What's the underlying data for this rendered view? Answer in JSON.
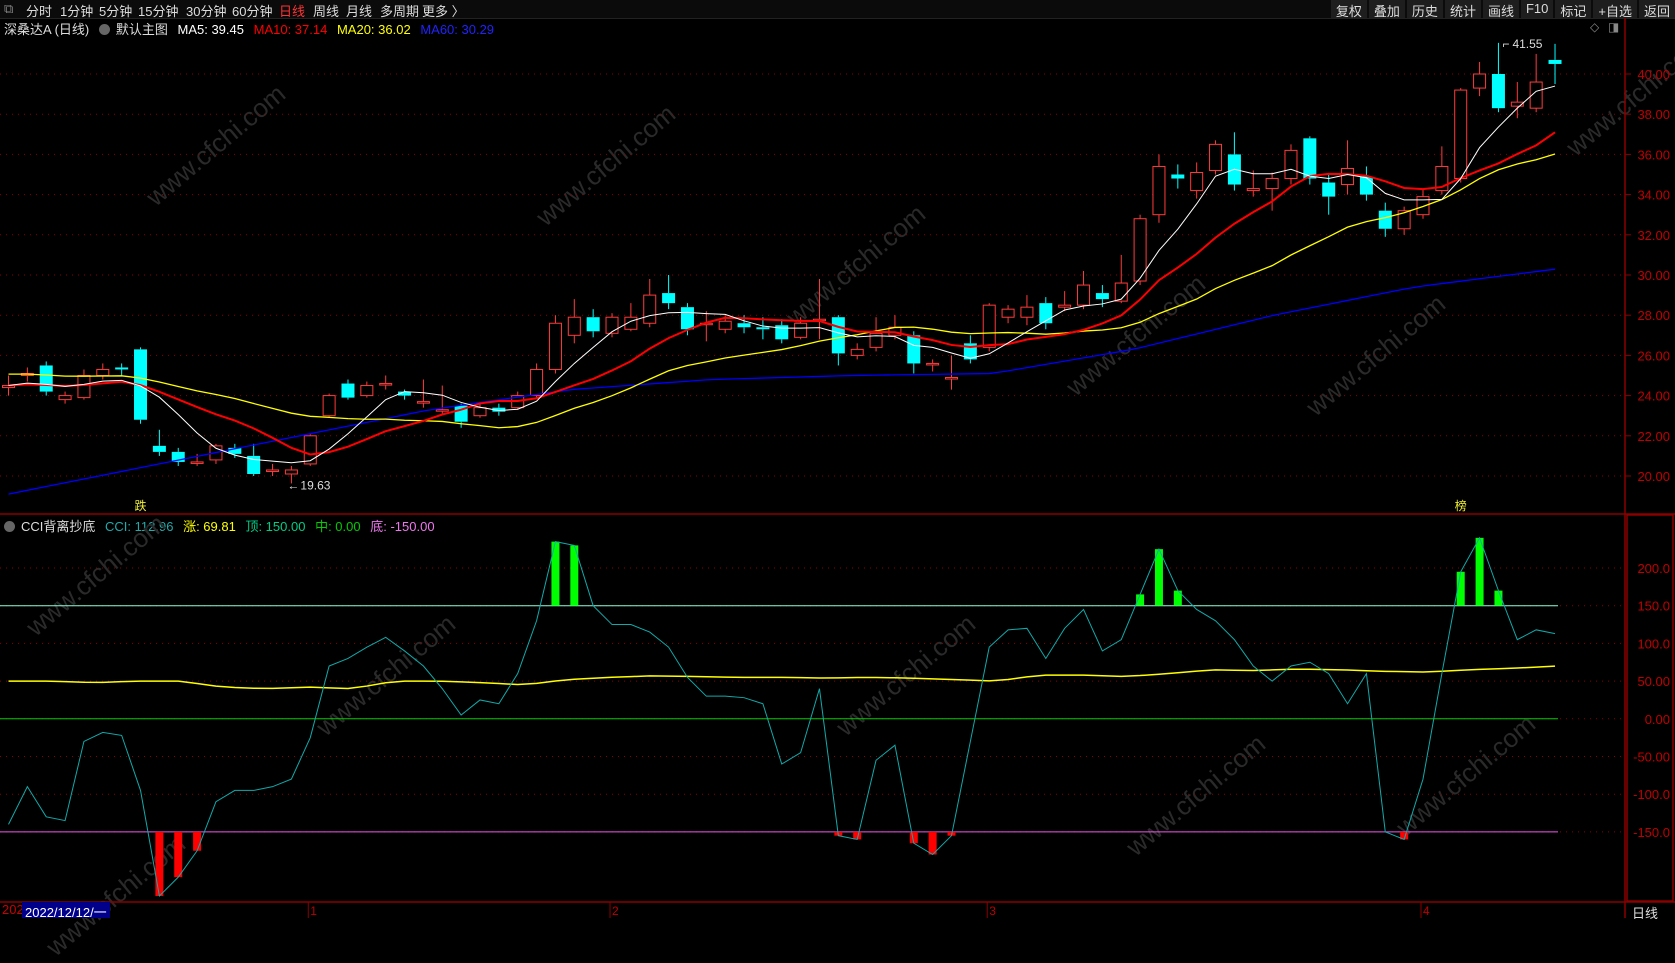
{
  "toolbar": {
    "tabs": [
      "分时",
      "1分钟",
      "5分钟",
      "15分钟",
      "30分钟",
      "60分钟",
      "日线",
      "周线",
      "月线",
      "多周期",
      "更多 〉"
    ],
    "active": "日线",
    "right_buttons": [
      "复权",
      "叠加",
      "历史",
      "统计",
      "画线",
      "F10",
      "标记",
      "+自选",
      "返回"
    ]
  },
  "main_legend": {
    "title": "深桑达A (日线)",
    "template": "默认主图",
    "ma5": "MA5: 39.45",
    "ma10": "MA10: 37.14",
    "ma20": "MA20: 36.02",
    "ma60": "MA60: 30.29"
  },
  "cci_legend": {
    "title": "CCI背离抄底",
    "cci": "CCI: 112.96",
    "zhang": "涨: 69.81",
    "ding": "顶: 150.00",
    "zhong": "中: 0.00",
    "di": "底: -150.00"
  },
  "annotations": {
    "high": "41.55",
    "low": "19.63",
    "signal_left": "跌",
    "signal_right": "榜"
  },
  "bottom": {
    "year_prefix": "202",
    "date": "2022/12/12/一",
    "months": [
      "1",
      "2",
      "3",
      "4"
    ],
    "period": "日线"
  },
  "watermark": "www.cfchi.com",
  "colors": {
    "up": "#ff3b3b",
    "down": "#00ffff",
    "ma5": "#ffffff",
    "ma10": "#ff0000",
    "ma20": "#ffff00",
    "ma60": "#0000ff",
    "grid": "#8b0000",
    "axis": "#c00000"
  },
  "chart_data": [
    {
      "type": "candlestick",
      "title": "深桑达A (日线)",
      "yticks": [
        "20.00",
        "22.00",
        "24.00",
        "26.00",
        "28.00",
        "30.00",
        "32.00",
        "34.00",
        "36.00",
        "38.00",
        "40.00"
      ],
      "ylim": [
        18.5,
        41.8
      ],
      "month_label_index": [
        16,
        32,
        52,
        75
      ],
      "ohlc": [
        [
          24.4,
          24.5,
          25.0,
          24.0
        ],
        [
          25.0,
          25.1,
          25.4,
          24.7
        ],
        [
          25.5,
          24.2,
          25.7,
          24.0
        ],
        [
          23.8,
          24.0,
          24.2,
          23.6
        ],
        [
          23.9,
          25.0,
          25.3,
          23.8
        ],
        [
          25.0,
          25.3,
          25.6,
          24.8
        ],
        [
          25.4,
          25.3,
          25.6,
          25.0
        ],
        [
          26.3,
          22.8,
          26.4,
          22.6
        ],
        [
          21.5,
          21.2,
          22.3,
          21.0
        ],
        [
          21.2,
          20.7,
          21.4,
          20.5
        ],
        [
          20.7,
          20.7,
          21.1,
          20.5
        ],
        [
          20.8,
          21.5,
          21.6,
          20.6
        ],
        [
          21.4,
          21.1,
          21.6,
          20.9
        ],
        [
          21.0,
          20.1,
          21.6,
          20.0
        ],
        [
          20.3,
          20.3,
          20.6,
          20.0
        ],
        [
          20.1,
          20.3,
          20.5,
          19.63
        ],
        [
          20.6,
          22.0,
          22.1,
          20.5
        ],
        [
          23.0,
          24.0,
          24.1,
          22.9
        ],
        [
          24.6,
          23.9,
          24.8,
          23.8
        ],
        [
          24.0,
          24.5,
          24.7,
          23.9
        ],
        [
          24.6,
          24.6,
          25.0,
          24.3
        ],
        [
          24.2,
          24.0,
          24.3,
          23.8
        ],
        [
          23.7,
          23.7,
          24.8,
          23.4
        ],
        [
          23.3,
          23.3,
          24.5,
          23.1
        ],
        [
          23.5,
          22.7,
          23.6,
          22.4
        ],
        [
          23.0,
          23.4,
          23.6,
          22.9
        ],
        [
          23.4,
          23.2,
          23.6,
          23.0
        ],
        [
          23.4,
          24.0,
          24.2,
          23.3
        ],
        [
          24.0,
          25.3,
          25.6,
          23.9
        ],
        [
          25.3,
          27.6,
          28.0,
          25.1
        ],
        [
          27.0,
          27.9,
          28.8,
          26.6
        ],
        [
          27.9,
          27.2,
          28.3,
          26.9
        ],
        [
          27.1,
          27.9,
          28.1,
          26.9
        ],
        [
          27.3,
          27.9,
          28.6,
          27.2
        ],
        [
          27.6,
          29.0,
          29.8,
          27.4
        ],
        [
          29.1,
          28.6,
          30.0,
          28.3
        ],
        [
          28.4,
          27.3,
          28.6,
          27.0
        ],
        [
          27.6,
          27.6,
          28.2,
          26.7
        ],
        [
          27.3,
          27.7,
          28.0,
          27.1
        ],
        [
          27.6,
          27.4,
          28.0,
          27.1
        ],
        [
          27.4,
          27.3,
          27.9,
          26.8
        ],
        [
          27.5,
          26.8,
          27.8,
          26.6
        ],
        [
          26.9,
          27.6,
          27.9,
          26.8
        ],
        [
          27.8,
          27.8,
          29.8,
          26.8
        ],
        [
          27.9,
          26.1,
          28.0,
          25.5
        ],
        [
          26.0,
          26.3,
          26.6,
          25.8
        ],
        [
          26.4,
          27.1,
          27.9,
          26.2
        ],
        [
          27.0,
          27.4,
          28.0,
          26.8
        ],
        [
          27.0,
          25.6,
          27.2,
          25.1
        ],
        [
          25.6,
          25.6,
          25.8,
          25.2
        ],
        [
          24.9,
          24.9,
          26.0,
          24.3
        ],
        [
          26.6,
          25.8,
          27.0,
          25.6
        ],
        [
          26.4,
          28.5,
          28.6,
          26.2
        ],
        [
          27.9,
          28.3,
          28.5,
          27.6
        ],
        [
          27.9,
          28.4,
          29.0,
          27.5
        ],
        [
          28.6,
          27.6,
          28.9,
          27.3
        ],
        [
          28.4,
          28.5,
          29.2,
          28.2
        ],
        [
          28.5,
          29.5,
          30.2,
          28.3
        ],
        [
          29.1,
          28.8,
          29.5,
          28.4
        ],
        [
          28.7,
          29.6,
          31.0,
          28.6
        ],
        [
          29.7,
          32.8,
          33.0,
          29.5
        ],
        [
          33.0,
          35.4,
          36.0,
          32.6
        ],
        [
          35.0,
          34.8,
          35.5,
          34.3
        ],
        [
          34.2,
          35.1,
          35.6,
          33.8
        ],
        [
          35.2,
          36.5,
          36.7,
          35.0
        ],
        [
          36.0,
          34.5,
          37.1,
          34.2
        ],
        [
          34.2,
          34.3,
          35.2,
          33.9
        ],
        [
          34.3,
          34.8,
          35.1,
          33.2
        ],
        [
          34.8,
          36.2,
          36.5,
          34.5
        ],
        [
          36.8,
          34.8,
          36.9,
          34.5
        ],
        [
          34.6,
          33.9,
          35.0,
          33.0
        ],
        [
          34.5,
          35.3,
          36.7,
          34.0
        ],
        [
          34.9,
          34.0,
          35.4,
          33.7
        ],
        [
          33.2,
          32.3,
          33.6,
          31.9
        ],
        [
          32.3,
          33.2,
          33.4,
          32.0
        ],
        [
          33.0,
          33.9,
          34.3,
          32.8
        ],
        [
          34.2,
          35.4,
          36.4,
          34.0
        ],
        [
          34.8,
          39.2,
          39.3,
          34.6
        ],
        [
          39.3,
          40.0,
          40.6,
          38.9
        ],
        [
          40.0,
          38.3,
          41.55,
          38.1
        ],
        [
          38.4,
          38.6,
          39.6,
          37.8
        ],
        [
          38.3,
          39.6,
          41.0,
          38.1
        ],
        [
          40.7,
          40.5,
          41.5,
          39.5
        ]
      ],
      "ma60_samples": [
        19.1,
        20.5,
        21.9,
        23.3,
        24.3,
        24.8,
        25.0,
        25.1,
        26.3,
        28.0,
        29.4,
        30.29
      ]
    },
    {
      "type": "line",
      "title": "CCI背离抄底",
      "yticks": [
        "200.0",
        "150.0",
        "100.0",
        "50.00",
        "0.00",
        "-50.00",
        "-100.0",
        "-150.0"
      ],
      "levels": {
        "top": 150,
        "mid": 0,
        "bottom": -150
      },
      "cci": [
        -140,
        -90,
        -130,
        -135,
        -30,
        -18,
        -22,
        -95,
        -235,
        -210,
        -175,
        -110,
        -95,
        -95,
        -90,
        -80,
        -25,
        70,
        80,
        95,
        108,
        90,
        70,
        40,
        5,
        25,
        20,
        60,
        130,
        235,
        230,
        150,
        125,
        125,
        115,
        95,
        55,
        30,
        30,
        28,
        20,
        -60,
        -45,
        40,
        -155,
        -160,
        -55,
        -35,
        -165,
        -180,
        -155,
        -30,
        95,
        118,
        120,
        80,
        120,
        145,
        90,
        105,
        165,
        225,
        170,
        145,
        130,
        105,
        70,
        50,
        70,
        75,
        60,
        20,
        60,
        -150,
        -160,
        -80,
        60,
        195,
        240,
        170,
        105,
        118,
        112.96
      ],
      "zhang_samples": [
        50,
        50,
        48,
        50,
        50,
        42,
        40,
        42,
        40,
        50,
        50,
        48,
        45,
        52,
        55,
        57,
        56,
        55,
        55,
        54,
        55,
        54,
        52,
        50,
        58,
        58,
        56,
        60,
        65,
        64,
        66,
        65,
        63,
        62,
        65,
        67,
        69.81
      ]
    }
  ]
}
